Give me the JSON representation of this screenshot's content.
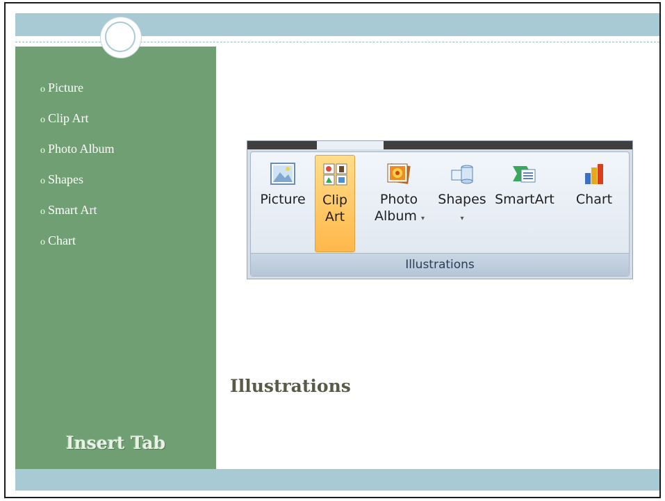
{
  "sidebar": {
    "items": [
      {
        "bullet": "o",
        "label": "Picture"
      },
      {
        "bullet": "o",
        "label": "Clip Art"
      },
      {
        "bullet": "o",
        "label": "Photo Album"
      },
      {
        "bullet": "o",
        "label": "Shapes"
      },
      {
        "bullet": "o",
        "label": "Smart Art"
      },
      {
        "bullet": "o",
        "label": "Chart"
      }
    ],
    "footer_title": "Insert Tab"
  },
  "main": {
    "section_title": "Illustrations"
  },
  "ribbon": {
    "group_label": "Illustrations",
    "buttons": [
      {
        "line1": "Picture",
        "line2": "",
        "icon": "picture-icon"
      },
      {
        "line1": "Clip",
        "line2": "Art",
        "icon": "clip-art-icon"
      },
      {
        "line1": "Photo",
        "line2": "Album",
        "icon": "photo-album-icon",
        "dropdown": true
      },
      {
        "line1": "Shapes",
        "line2": "",
        "icon": "shapes-icon",
        "dropdown": true
      },
      {
        "line1": "SmartArt",
        "line2": "",
        "icon": "smartart-icon"
      },
      {
        "line1": "Chart",
        "line2": "",
        "icon": "chart-icon"
      }
    ],
    "dropdown_glyph": "▾"
  },
  "colors": {
    "sidebar": "#6f9f72",
    "band": "#a7cad4",
    "highlight": "#ffc763"
  }
}
